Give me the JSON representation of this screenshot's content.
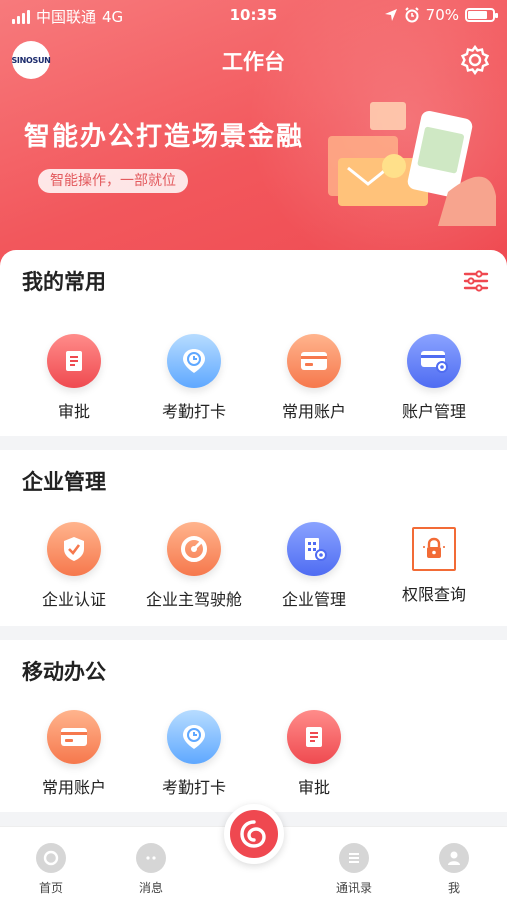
{
  "status_bar": {
    "carrier": "中国联通",
    "network": "4G",
    "time": "10:35",
    "battery": "70%"
  },
  "header": {
    "logo_text": "SINOSUN",
    "title": "工作台"
  },
  "banner": {
    "title": "智能办公打造场景金融",
    "subtitle": "智能操作，一部就位"
  },
  "sections": {
    "common": {
      "title": "我的常用",
      "items": [
        {
          "label": "审批",
          "icon": "approval-icon"
        },
        {
          "label": "考勤打卡",
          "icon": "clock-in-icon"
        },
        {
          "label": "常用账户",
          "icon": "card-icon"
        },
        {
          "label": "账户管理",
          "icon": "card-settings-icon"
        }
      ]
    },
    "enterprise": {
      "title": "企业管理",
      "items": [
        {
          "label": "企业认证",
          "icon": "shield-check-icon"
        },
        {
          "label": "企业主驾驶舱",
          "icon": "dashboard-gauge-icon"
        },
        {
          "label": "企业管理",
          "icon": "building-gear-icon"
        },
        {
          "label": "权限查询",
          "icon": "lock-icon"
        }
      ]
    },
    "mobile": {
      "title": "移动办公",
      "items": [
        {
          "label": "常用账户",
          "icon": "card-icon"
        },
        {
          "label": "考勤打卡",
          "icon": "clock-in-icon"
        },
        {
          "label": "审批",
          "icon": "approval-icon"
        }
      ]
    }
  },
  "tabbar": {
    "items": [
      {
        "label": "首页",
        "icon": "home-icon"
      },
      {
        "label": "消息",
        "icon": "message-icon"
      },
      {
        "label": "",
        "icon": "center-logo-icon"
      },
      {
        "label": "通讯录",
        "icon": "contacts-icon"
      },
      {
        "label": "我",
        "icon": "profile-icon"
      }
    ]
  },
  "colors": {
    "primary": "#ef4850",
    "accent_orange": "#f6784d",
    "accent_blue": "#5fa8ff",
    "accent_indigo": "#4f6cf2"
  }
}
